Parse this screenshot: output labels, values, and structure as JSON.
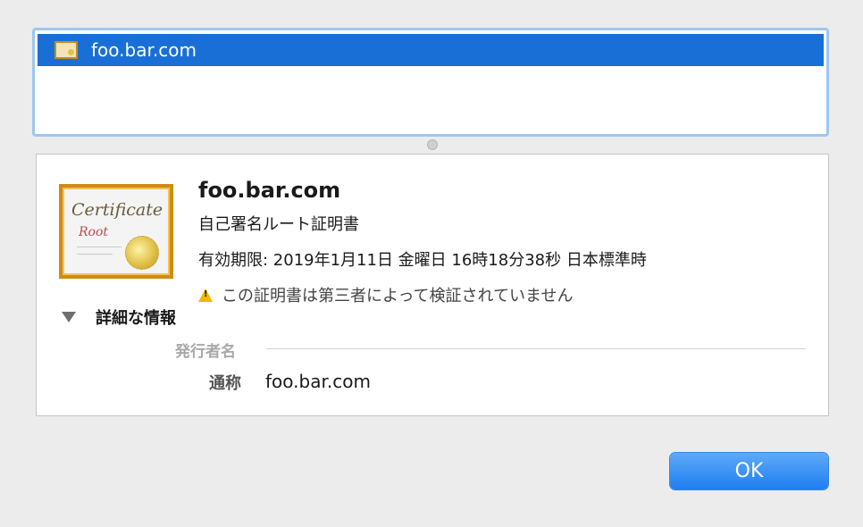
{
  "cert_tree": {
    "selected_item": "foo.bar.com"
  },
  "certificate": {
    "icon_title": "Certificate",
    "icon_subtitle": "Root",
    "name": "foo.bar.com",
    "type": "自己署名ルート証明書",
    "expires": "有効期限: 2019年1月11日 金曜日 16時18分38秒 日本標準時",
    "warning": "この証明書は第三者によって検証されていません"
  },
  "details": {
    "toggle_label": "詳細な情報",
    "section_issuer": "発行者名",
    "common_name_label": "通称",
    "common_name_value": "foo.bar.com"
  },
  "footer": {
    "ok_label": "OK"
  },
  "colors": {
    "selection": "#1a6fd6",
    "button": "#1f7ef0",
    "warning": "#f0b800",
    "cert_frame": "#d18b10"
  }
}
